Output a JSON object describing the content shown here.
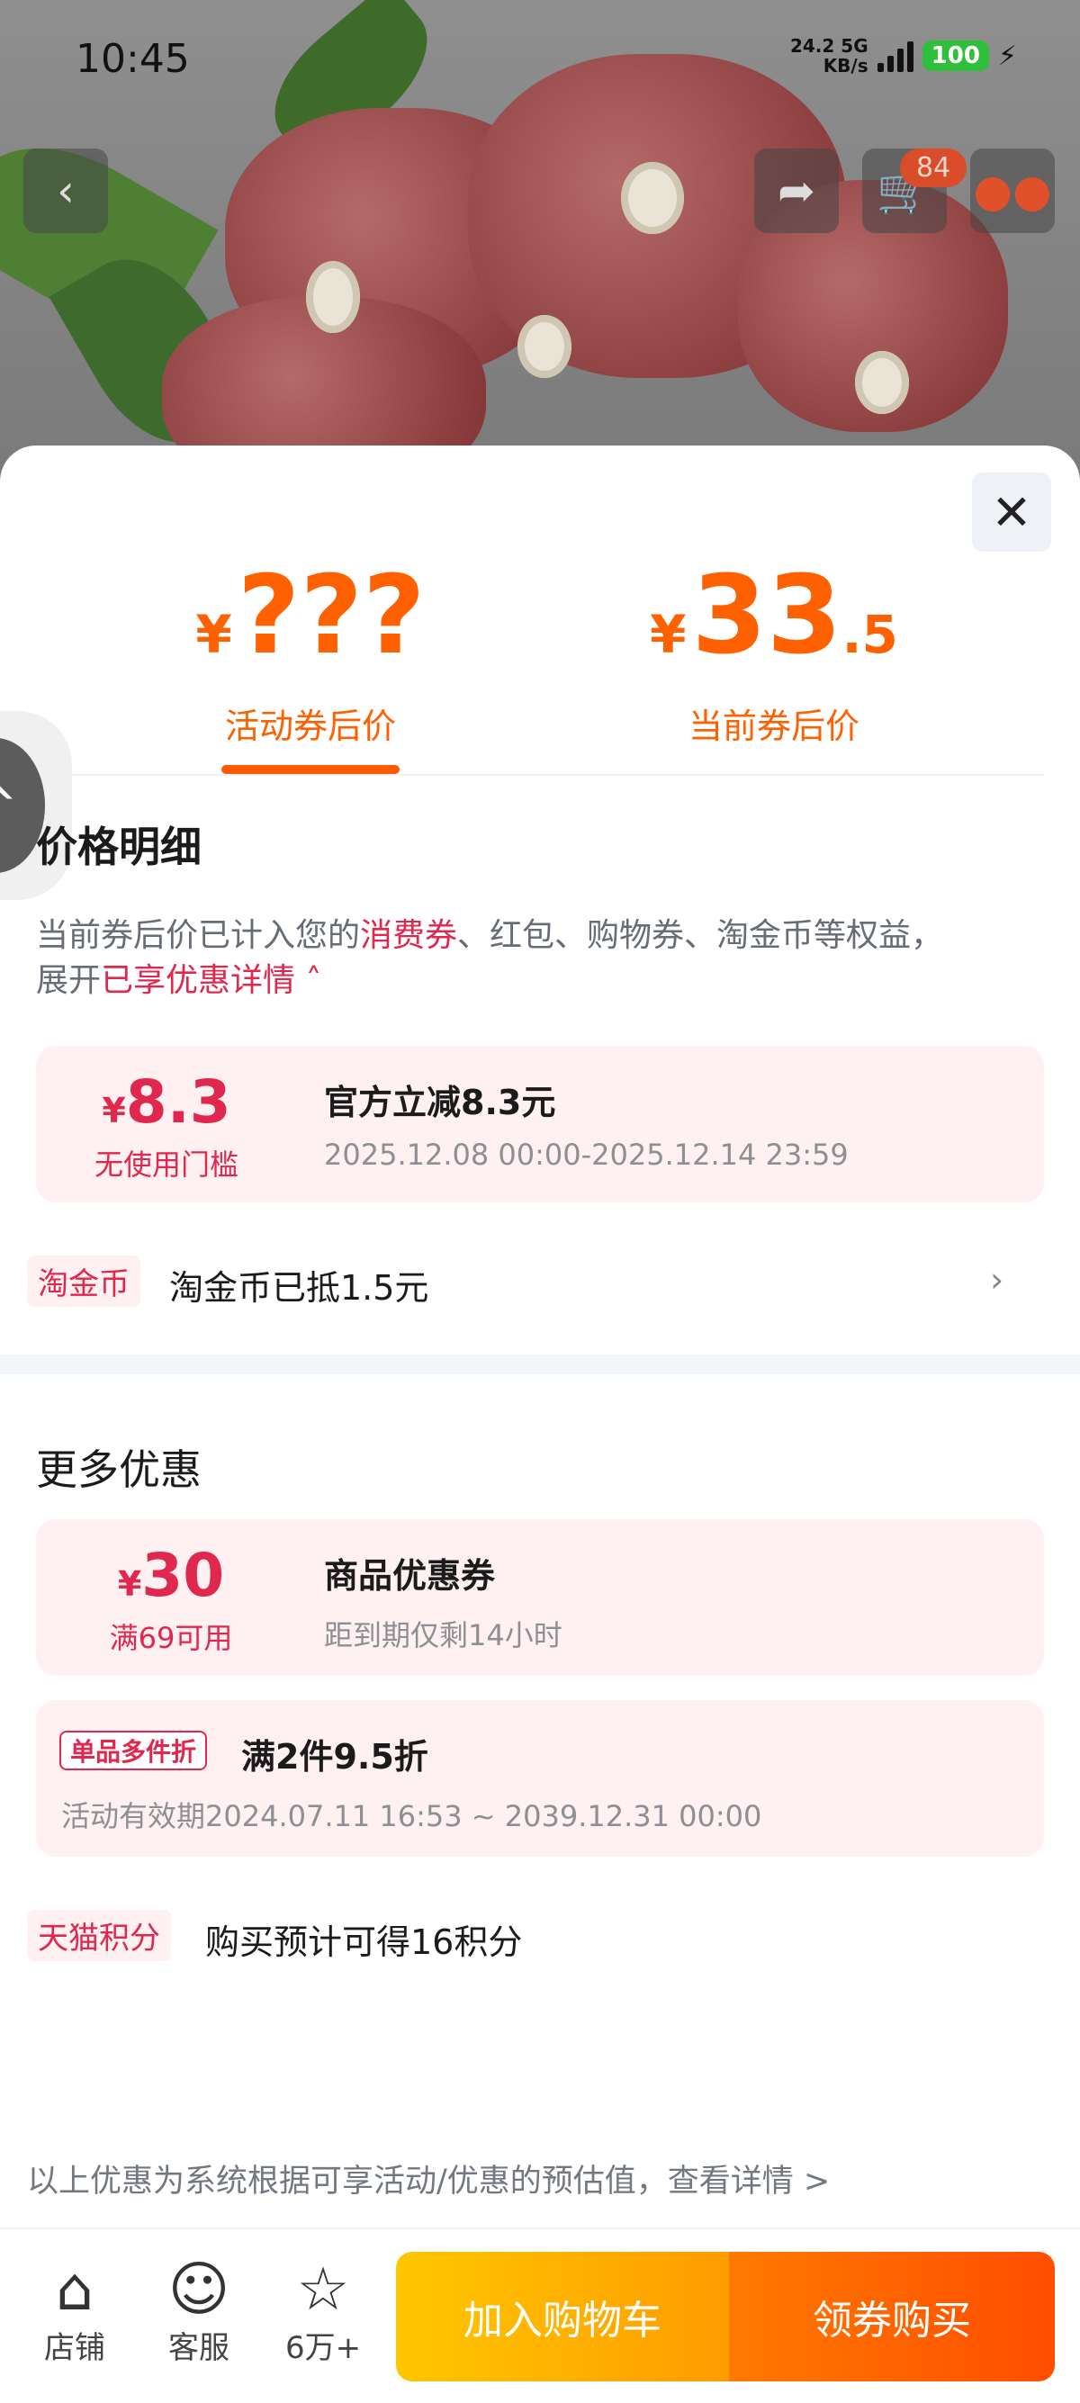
{
  "status_bar": {
    "time": "10:45",
    "net_speed": "24.2",
    "net_unit": "KB/s",
    "network": "5G",
    "battery": "100"
  },
  "header": {
    "cart_count": "84"
  },
  "prices": {
    "tabs": [
      {
        "currency": "¥",
        "value": "???",
        "decimal": "",
        "label": "活动券后价"
      },
      {
        "currency": "¥",
        "value": "33",
        "decimal": ".5",
        "label": "当前券后价"
      }
    ]
  },
  "price_detail": {
    "title": "价格明细",
    "desc_prefix": "当前券后价已计入您的",
    "desc_highlight1": "消费券",
    "desc_middle": "、红包、购物券、淘金币等权益，",
    "desc_line2_prefix": "展开",
    "desc_highlight2": "已享优惠详情",
    "coupon": {
      "currency": "¥",
      "amount": "8.3",
      "condition": "无使用门槛",
      "title": "官方立减8.3元",
      "validity": "2025.12.08 00:00-2025.12.14 23:59"
    },
    "coin_tag": "淘金币",
    "coin_text": "淘金币已抵1.5元"
  },
  "more_offers": {
    "title": "更多优惠",
    "coupon": {
      "currency": "¥",
      "amount": "30",
      "condition": "满69可用",
      "title": "商品优惠券",
      "sub": "距到期仅剩14小时"
    },
    "multi": {
      "tag": "单品多件折",
      "title": "满2件9.5折",
      "validity": "活动有效期2024.07.11 16:53 ~ 2039.12.31 00:00"
    },
    "points_tag": "天猫积分",
    "points_text": "购买预计可得16积分"
  },
  "footer_note": "以上优惠为系统根据可享活动/优惠的预估值，查看详情 >",
  "bottom_bar": {
    "shop": "店铺",
    "service": "客服",
    "favorites": "6万+",
    "add_cart": "加入购物车",
    "buy": "领券购买"
  },
  "colors": {
    "accent_orange": "#ff6000",
    "accent_red": "#e0284f"
  }
}
